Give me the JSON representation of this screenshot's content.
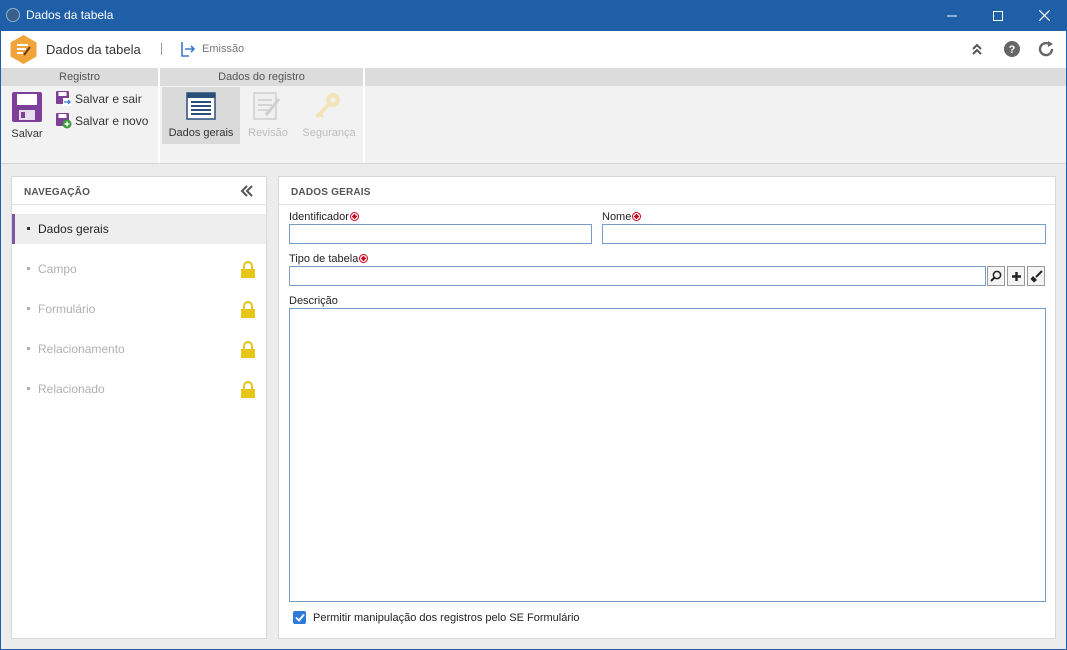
{
  "window": {
    "title": "Dados da tabela"
  },
  "header": {
    "app_title": "Dados da tabela",
    "emissao_label": "Emissão",
    "icons": [
      "collapse-up-icon",
      "help-icon",
      "refresh-icon"
    ]
  },
  "ribbon": {
    "groups": {
      "registro": "Registro",
      "dados_registro": "Dados do registro"
    },
    "buttons": {
      "salvar": "Salvar",
      "salvar_sair": "Salvar e sair",
      "salvar_novo": "Salvar e novo",
      "dados_gerais": "Dados gerais",
      "revisao": "Revisão",
      "seguranca": "Segurança"
    }
  },
  "nav": {
    "title": "NAVEGAÇÃO",
    "items": [
      {
        "label": "Dados gerais",
        "active": true,
        "locked": false
      },
      {
        "label": "Campo",
        "active": false,
        "locked": true
      },
      {
        "label": "Formulário",
        "active": false,
        "locked": true
      },
      {
        "label": "Relacionamento",
        "active": false,
        "locked": true
      },
      {
        "label": "Relacionado",
        "active": false,
        "locked": true
      }
    ]
  },
  "form": {
    "title": "DADOS GERAIS",
    "identificador": {
      "label": "Identificador",
      "value": "",
      "required": true
    },
    "nome": {
      "label": "Nome",
      "value": "",
      "required": true
    },
    "tipo_tabela": {
      "label": "Tipo de tabela",
      "value": "",
      "required": true
    },
    "descricao": {
      "label": "Descrição",
      "value": ""
    },
    "checkbox": {
      "label": "Permitir manipulação dos registros pelo SE Formulário",
      "checked": true
    }
  },
  "colors": {
    "titlebar": "#1f5fa8",
    "accent_purple": "#7e57a0",
    "logo_orange": "#f0a43a",
    "lock_yellow": "#e6c619",
    "required_red": "#d0021b",
    "checkbox_blue": "#2f7bd9"
  }
}
